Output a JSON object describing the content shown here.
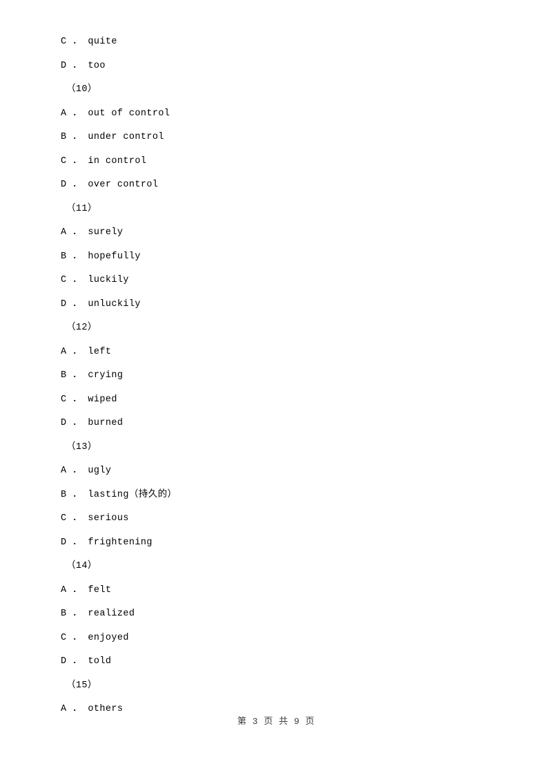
{
  "document": {
    "lines": [
      {
        "text": "A ． others",
        "style": "option"
      }
    ],
    "body": [
      {
        "text": "C ． quite",
        "style": "option"
      },
      {
        "text": "D ． too",
        "style": "option"
      },
      {
        "text": "（10）",
        "style": "group"
      },
      {
        "text": "A ． out of control",
        "style": "option"
      },
      {
        "text": "B ． under control",
        "style": "option"
      },
      {
        "text": "C ． in control",
        "style": "option"
      },
      {
        "text": "D ． over control",
        "style": "option"
      },
      {
        "text": "（11）",
        "style": "group"
      },
      {
        "text": "A ． surely",
        "style": "option"
      },
      {
        "text": "B ． hopefully",
        "style": "option"
      },
      {
        "text": "C ． luckily",
        "style": "option"
      },
      {
        "text": "D ． unluckily",
        "style": "option"
      },
      {
        "text": "（12）",
        "style": "group"
      },
      {
        "text": "A ． left",
        "style": "option"
      },
      {
        "text": "B ． crying",
        "style": "option"
      },
      {
        "text": "C ． wiped",
        "style": "option"
      },
      {
        "text": "D ． burned",
        "style": "option"
      },
      {
        "text": "（13）",
        "style": "group"
      },
      {
        "text": "A ． ugly",
        "style": "option"
      },
      {
        "text": "B ． lasting（持久的）",
        "style": "option"
      },
      {
        "text": "C ． serious",
        "style": "option"
      },
      {
        "text": "D ． frightening",
        "style": "option"
      },
      {
        "text": "（14）",
        "style": "group"
      },
      {
        "text": "A ． felt",
        "style": "option"
      },
      {
        "text": "B ． realized",
        "style": "option"
      },
      {
        "text": "C ． enjoyed",
        "style": "option"
      },
      {
        "text": "D ． told",
        "style": "option"
      },
      {
        "text": "（15）",
        "style": "group"
      },
      {
        "text": "A ． others",
        "style": "option"
      }
    ],
    "footer": "第 3 页 共 9 页"
  }
}
